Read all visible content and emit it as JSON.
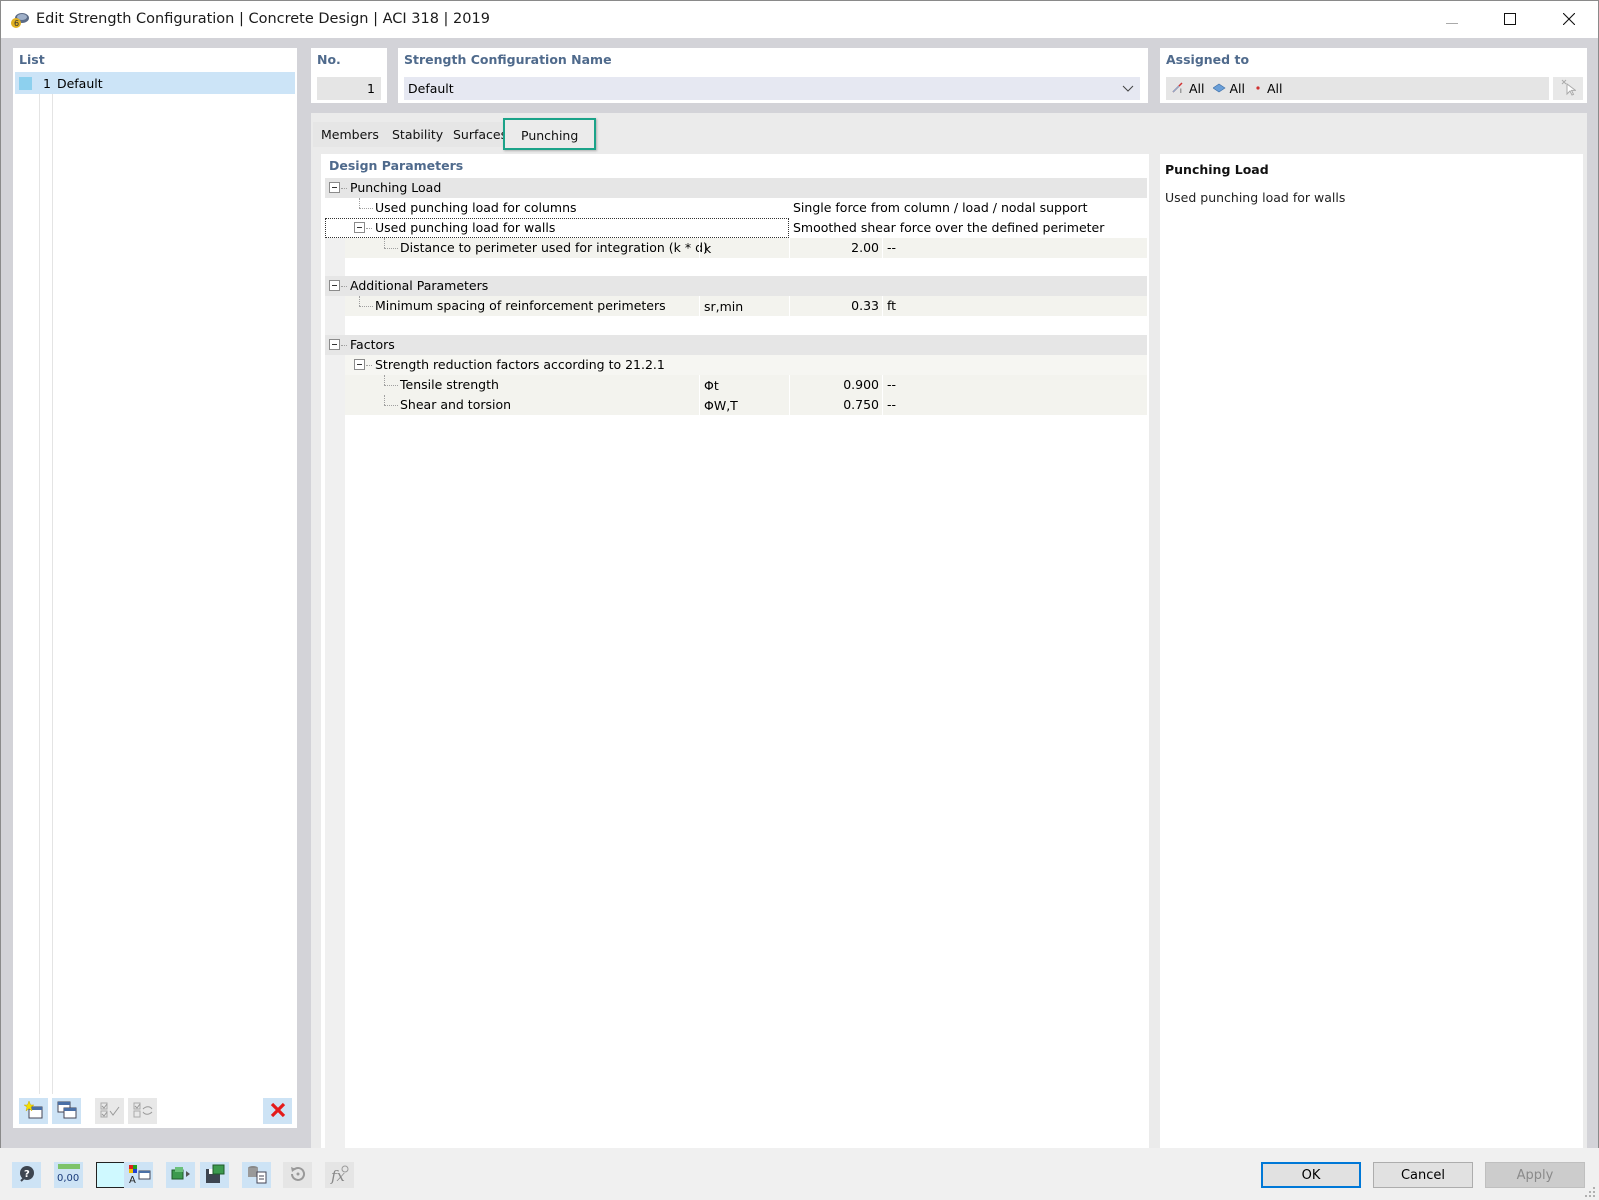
{
  "window": {
    "title": "Edit Strength Configuration | Concrete Design | ACI 318 | 2019",
    "controls": [
      "minimize-icon",
      "maximize-icon",
      "close-icon"
    ]
  },
  "list": {
    "label": "List",
    "items": [
      {
        "no": "1",
        "name": "Default",
        "color": "#8dd0ee",
        "selected": true
      }
    ],
    "toolbar": [
      {
        "icon": "new-item-icon",
        "enabled": true
      },
      {
        "icon": "copy-item-icon",
        "enabled": true
      },
      {
        "icon": "check-all-icon",
        "enabled": false
      },
      {
        "icon": "check-toggle-icon",
        "enabled": false
      },
      {
        "icon": "delete-icon",
        "enabled": true
      }
    ]
  },
  "header": {
    "no_label": "No.",
    "no_value": "1",
    "name_label": "Strength Configuration Name",
    "name_value": "Default",
    "assigned_label": "Assigned to",
    "assigned": [
      {
        "icon": "members-icon",
        "label": "All"
      },
      {
        "icon": "surfaces-icon",
        "label": "All"
      },
      {
        "icon": "nodes-icon",
        "label": "All"
      }
    ]
  },
  "tabs": [
    {
      "label": "Members",
      "active": false
    },
    {
      "label": "Stability",
      "active": false
    },
    {
      "label": "Surfaces",
      "active": false
    },
    {
      "label": "Punching",
      "active": true
    }
  ],
  "design_parameters": {
    "label": "Design Parameters",
    "groups": [
      {
        "title": "Punching Load",
        "rows": [
          {
            "label": "Used punching load for columns",
            "value": "Single force from column / load / nodal support"
          },
          {
            "label": "Used punching load for walls",
            "value": "Smoothed shear force over the defined perimeter",
            "focused": true,
            "children": [
              {
                "label": "Distance to perimeter used for integration (k * d)",
                "symbol": "k",
                "value": "2.00",
                "unit": "--"
              }
            ]
          }
        ]
      },
      {
        "title": "Additional Parameters",
        "rows": [
          {
            "label": "Minimum spacing of reinforcement perimeters",
            "symbol": "sr,min",
            "value": "0.33",
            "unit": "ft"
          }
        ]
      },
      {
        "title": "Factors",
        "rows": [
          {
            "label": "Strength reduction factors according to 21.2.1",
            "children": [
              {
                "label": "Tensile strength",
                "symbol": "Φt",
                "value": "0.900",
                "unit": "--"
              },
              {
                "label": "Shear and torsion",
                "symbol": "ΦW,T",
                "value": "0.750",
                "unit": "--"
              }
            ]
          }
        ]
      }
    ]
  },
  "info": {
    "title": "Punching Load",
    "text": "Used punching load for walls"
  },
  "bottom_toolbar": [
    {
      "icon": "help-icon"
    },
    {
      "icon": "units-icon",
      "label": "0,00"
    },
    {
      "icon": "color-swatch-icon"
    },
    {
      "icon": "display-properties-icon"
    },
    {
      "icon": "export-icon"
    },
    {
      "icon": "save-icon"
    },
    {
      "icon": "database-icon"
    },
    {
      "icon": "reset-icon",
      "enabled": false
    },
    {
      "icon": "formula-icon",
      "enabled": false
    }
  ],
  "buttons": {
    "ok": "OK",
    "cancel": "Cancel",
    "apply": "Apply"
  }
}
